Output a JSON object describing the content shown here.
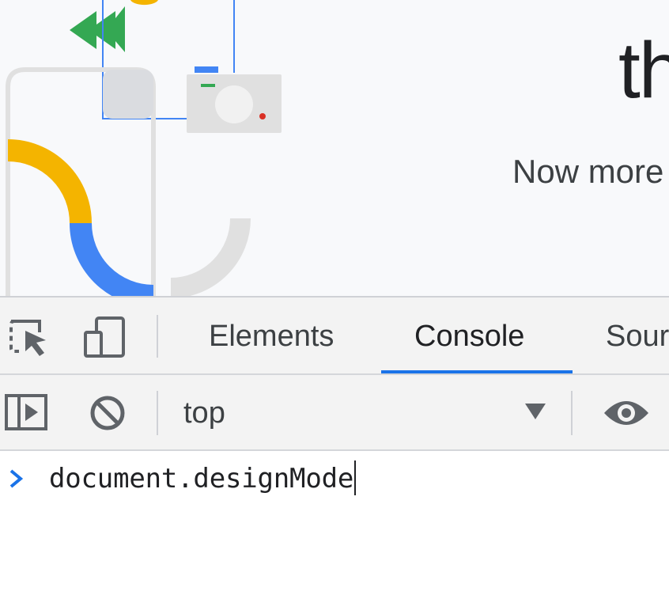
{
  "page": {
    "hero_title": "th",
    "hero_subtitle": "Now more"
  },
  "devtools": {
    "toolbar_icons": {
      "inspect": "select-element-icon",
      "device": "device-toolbar-icon"
    },
    "tabs": [
      {
        "label": "Elements",
        "active": false
      },
      {
        "label": "Console",
        "active": true
      },
      {
        "label": "Sour",
        "active": false
      }
    ],
    "console_toolbar": {
      "sidebar_icon": "sidebar-toggle-icon",
      "clear_icon": "clear-console-icon",
      "context": "top",
      "live_expression_icon": "eye-icon"
    },
    "console": {
      "input": "document.designMode"
    }
  },
  "colors": {
    "accent": "#1a73e8",
    "yellow": "#f4b400",
    "green": "#34a853",
    "red": "#d93025"
  }
}
